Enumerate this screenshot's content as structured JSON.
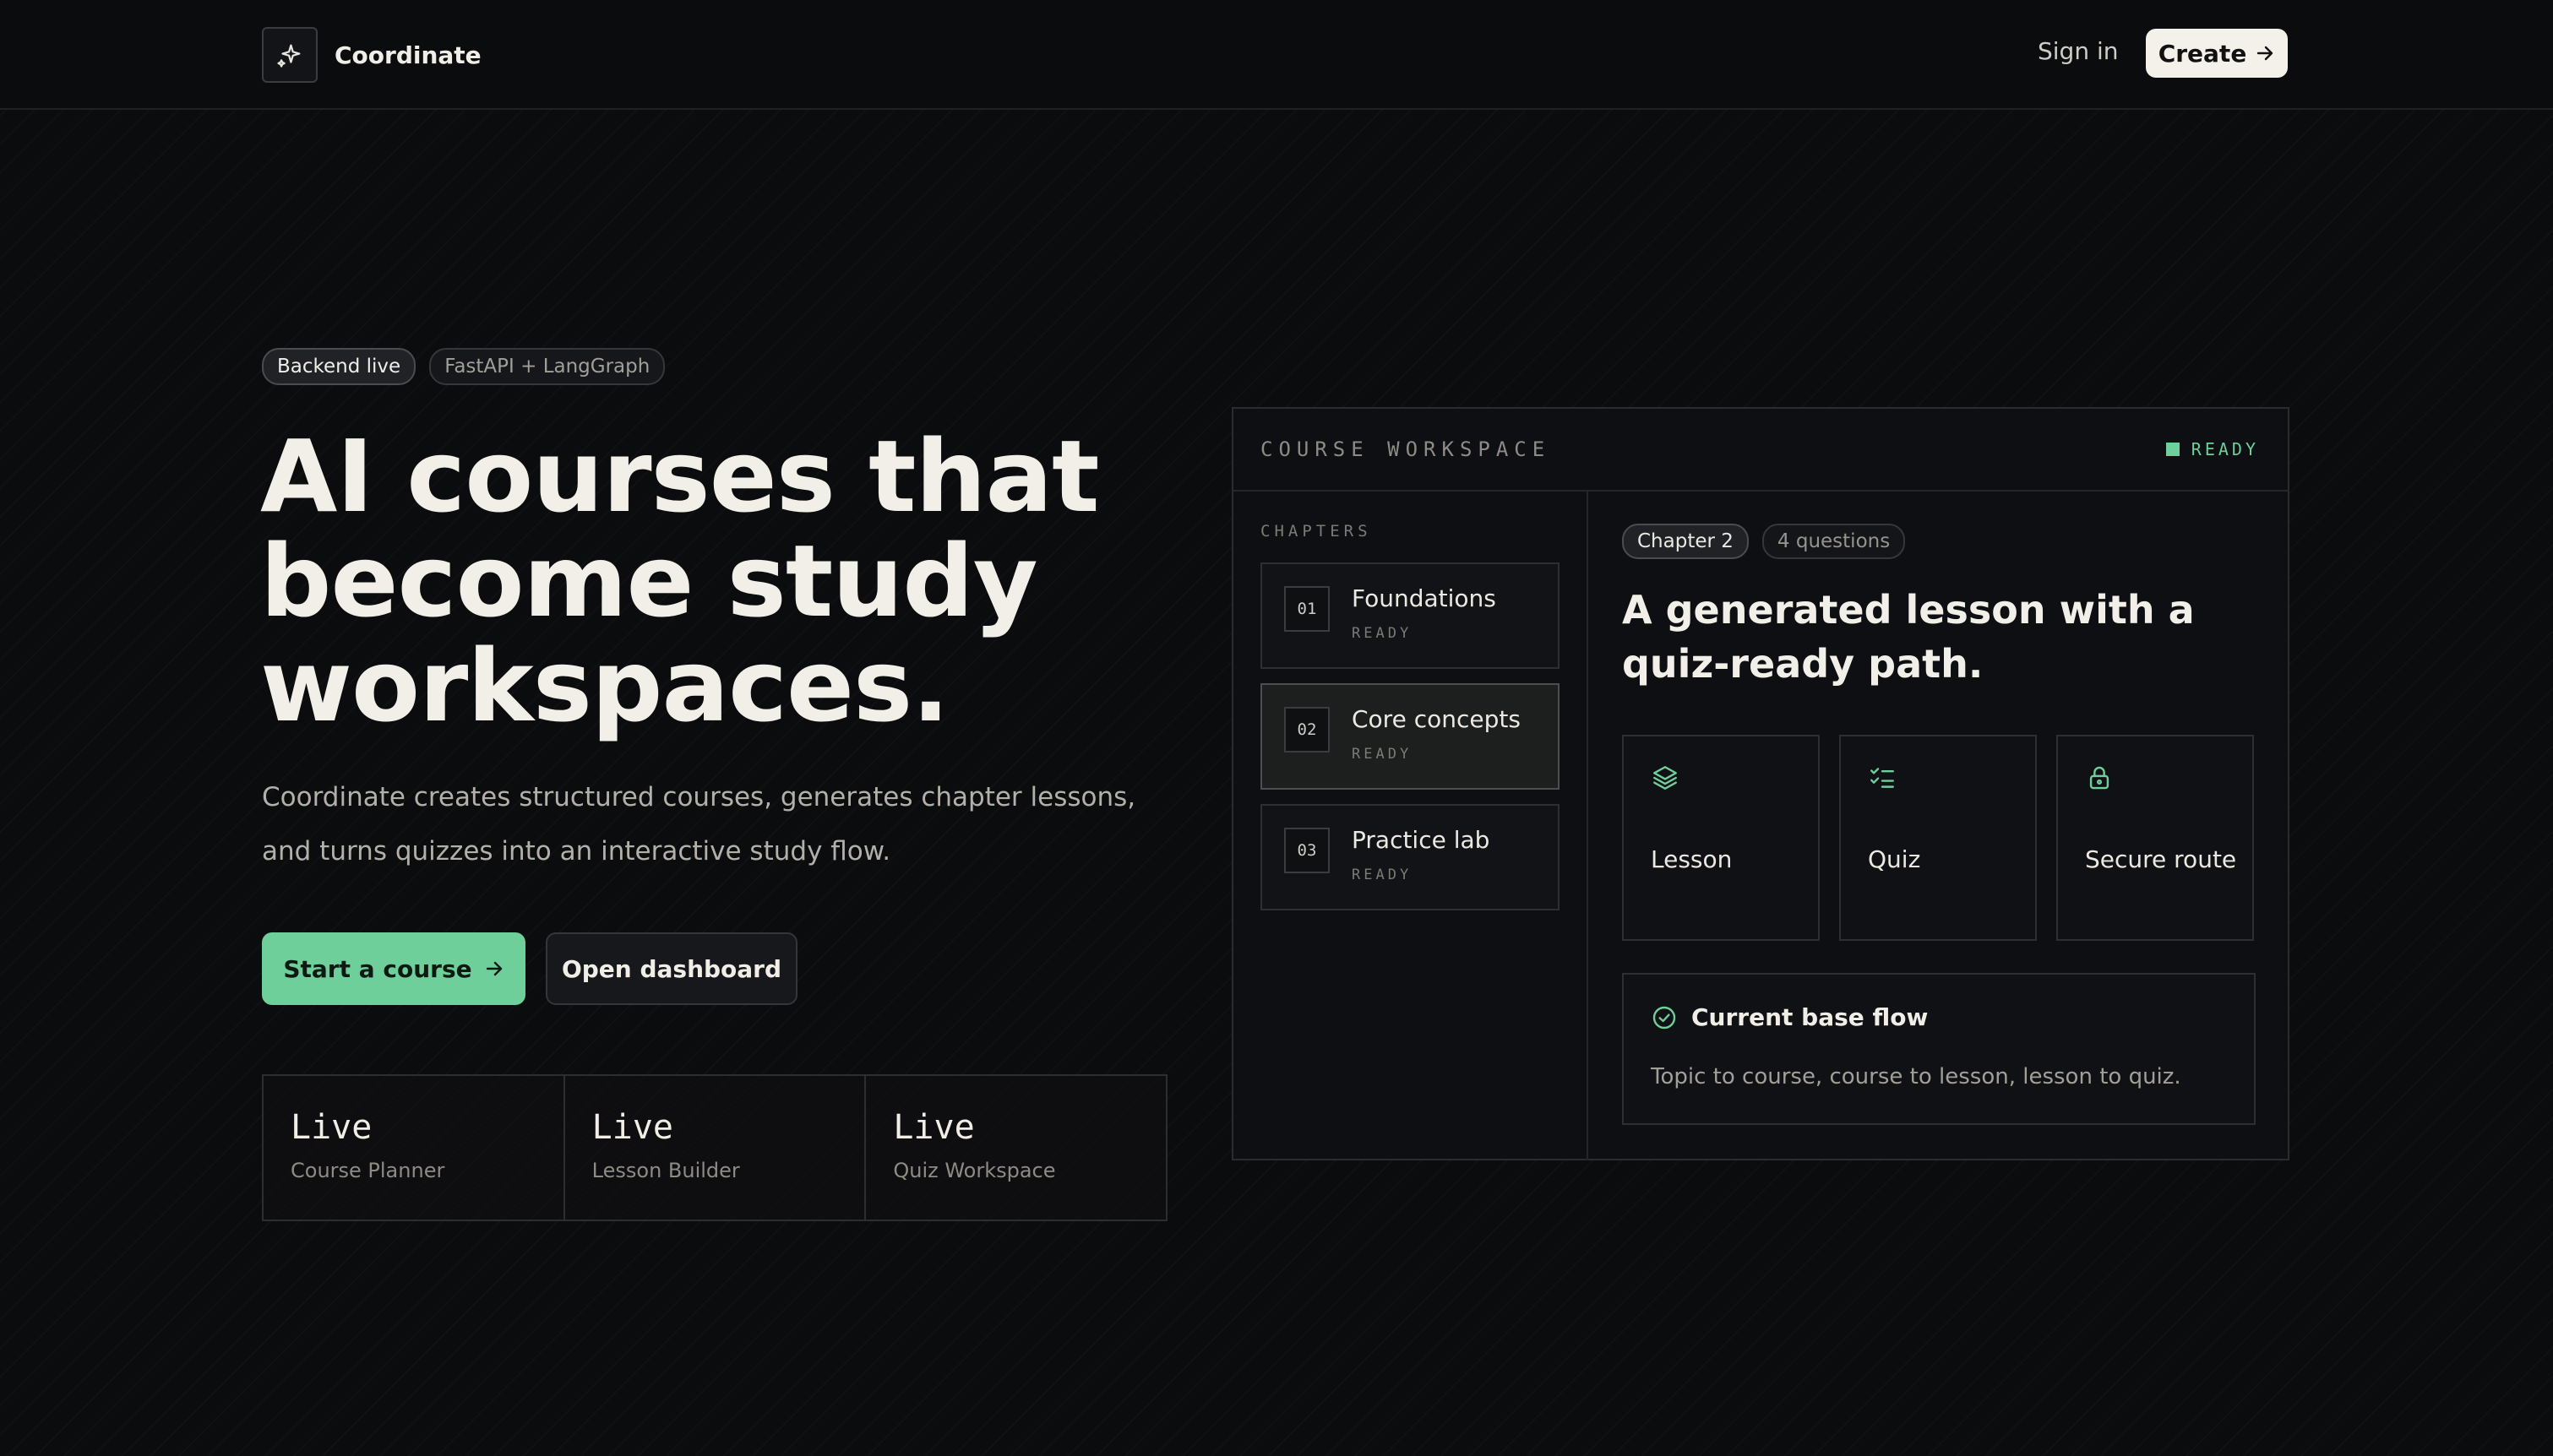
{
  "nav": {
    "brand": "Coordinate",
    "sign_in": "Sign in",
    "create": "Create"
  },
  "hero": {
    "badges": [
      "Backend live",
      "FastAPI + LangGraph"
    ],
    "title_lines": [
      "AI courses that",
      "become study",
      "workspaces."
    ],
    "subtitle": "Coordinate creates structured courses, generates chapter lessons, and turns quizzes into an interactive study flow.",
    "primary_cta": "Start a course",
    "secondary_cta": "Open dashboard",
    "stats": [
      {
        "value": "Live",
        "label": "Course Planner"
      },
      {
        "value": "Live",
        "label": "Lesson Builder"
      },
      {
        "value": "Live",
        "label": "Quiz Workspace"
      }
    ]
  },
  "workspace": {
    "title": "COURSE WORKSPACE",
    "status": "READY",
    "chapters_heading": "CHAPTERS",
    "chapters": [
      {
        "num": "01",
        "name": "Foundations",
        "status": "READY"
      },
      {
        "num": "02",
        "name": "Core concepts",
        "status": "READY"
      },
      {
        "num": "03",
        "name": "Practice lab",
        "status": "READY"
      }
    ],
    "active_chapter": 1,
    "tags": [
      "Chapter 2",
      "4 questions"
    ],
    "lesson_title": "A generated lesson with a quiz-ready path.",
    "features": [
      {
        "icon": "layers-icon",
        "label": "Lesson"
      },
      {
        "icon": "checklist-icon",
        "label": "Quiz"
      },
      {
        "icon": "lock-icon",
        "label": "Secure route"
      }
    ],
    "flow": {
      "title": "Current base flow",
      "text": "Topic to course, course to lesson, lesson to quiz."
    }
  },
  "colors": {
    "accent": "#6ecf9b",
    "background": "#0b0c0e",
    "text": "#f2efe8"
  }
}
